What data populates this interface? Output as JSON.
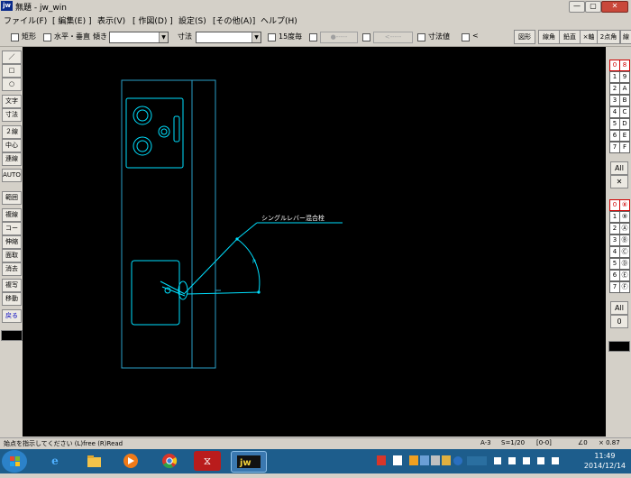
{
  "window": {
    "title": "無題 - jw_win",
    "logo": "jw",
    "minimize": "—",
    "maximize": "▢",
    "close": "✕"
  },
  "menu": [
    "ファイル(F)",
    "[ 編集(E) ]",
    "表示(V)",
    "[ 作図(D) ]",
    "設定(S)",
    "[その他(A)]",
    "ヘルプ(H)"
  ],
  "toolbar": {
    "rect_label": "矩形",
    "hv_label": "水平・垂直",
    "tilt_label": "傾き",
    "tilt_value": "",
    "dim_label": "寸法",
    "dim_value": "",
    "angle15_label": "15度毎",
    "dot_btn": "●-----",
    "arrow_btn": "<-----",
    "dimvalue_label": "寸法値",
    "lt_label": "<",
    "right_buttons": [
      "図形",
      "線角",
      "鉛直",
      "×軸",
      "2点角",
      "線"
    ]
  },
  "left_tools": [
    "／",
    "□",
    "○",
    "文字",
    "寸法",
    "２線",
    "中心線",
    "連線",
    "AUTO",
    "範囲",
    "複線",
    "コーナー",
    "伸縮",
    "面取",
    "消去",
    "複写",
    "移動",
    "戻る"
  ],
  "right_tools": {
    "group1_left": [
      "0",
      "1",
      "2",
      "3",
      "4",
      "5",
      "6",
      "7"
    ],
    "group1_right": [
      "8",
      "9",
      "A",
      "B",
      "C",
      "D",
      "E",
      "F"
    ],
    "all_label": "All",
    "x_label": "✕",
    "group2_left": [
      "0",
      "1",
      "2",
      "3",
      "4",
      "5",
      "6",
      "7"
    ],
    "group2_right": [
      "⑧",
      "⑨",
      "Ⓐ",
      "Ⓑ",
      "Ⓒ",
      "Ⓓ",
      "Ⓔ",
      "Ⓕ"
    ],
    "all2_label": "All",
    "zero_label": "0"
  },
  "drawing": {
    "annotation": "シングルレバー混合栓"
  },
  "status": {
    "hint": "始点を指示してください (L)free (R)Read",
    "paper": "A-3",
    "scale": "S=1/20",
    "layer": "[0-0]",
    "angle": "∠0",
    "zoom": "× 0.87"
  },
  "taskbar": {
    "time": "11:49",
    "date": "2014/12/14",
    "apps": [
      "ie-icon",
      "folder-icon",
      "media-player-icon",
      "chrome-icon",
      "acrobat-icon",
      "jw-cad-icon"
    ]
  },
  "colors": {
    "canvas": "#000000",
    "line": "#00e0ff",
    "taskbar": "#1d5d8c"
  }
}
